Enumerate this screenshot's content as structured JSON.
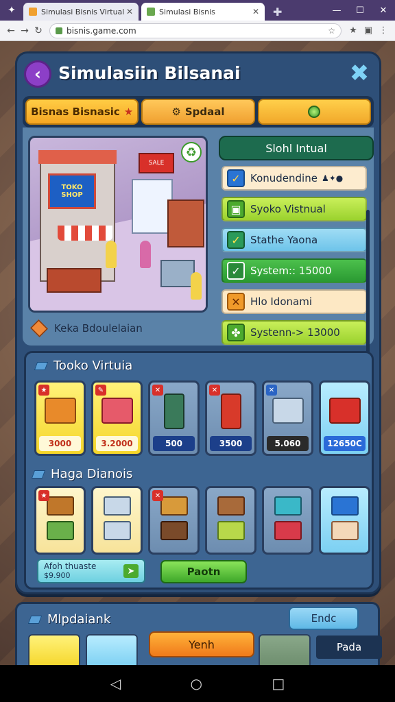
{
  "browser": {
    "tabs": [
      {
        "title": "Simulasi Bisnis Virtual",
        "fav_color": "#f0a030"
      },
      {
        "title": "Simulasi Bisnis",
        "fav_color": "#6aa84f"
      }
    ],
    "url": "bisnis.game.com",
    "icons": [
      "puzzle-icon",
      "new-tab-icon",
      "minimize-icon",
      "maximize-icon",
      "close-icon",
      "back-icon",
      "forward-icon",
      "reload-icon",
      "star-icon",
      "extension-icon"
    ]
  },
  "game": {
    "title": "Simulasiin Bilsanai",
    "tabs": [
      {
        "label": "Bisnas Bisnasic",
        "icon": "★"
      },
      {
        "label": "Spdaal",
        "icon": "⚙"
      },
      {
        "label": ""
      }
    ],
    "scene": {
      "billboard": "TOKO SHOP",
      "red_sign": "SALE",
      "caption": "Keka Bdoulelaian"
    },
    "side_header": "Slohl Intual",
    "side_items": [
      {
        "label": "Konudendine",
        "mark": "✓",
        "extras": "♟✦●"
      },
      {
        "label": "Syoko Vistnual",
        "mark": "▣"
      },
      {
        "label": "Stathe Yaona",
        "mark": "✓"
      },
      {
        "label": "System:: 15000",
        "mark": "✓"
      },
      {
        "label": "Hlo Idonami",
        "mark": "✕"
      },
      {
        "label": "Systenn-> 13000",
        "mark": "✤"
      }
    ],
    "store_title": "Tooko Virtuia",
    "store_items": [
      {
        "price": "3000"
      },
      {
        "price": "3.2000"
      },
      {
        "price": "500"
      },
      {
        "price": "3500"
      },
      {
        "price": "5.060"
      },
      {
        "price": "12650C"
      }
    ],
    "second_title": "Haga Dianois",
    "promo": {
      "line1": "Afoh thuaste",
      "line2": "$9.900"
    },
    "primary_button": "Paotn",
    "bottom_title": "Mlpdaiank",
    "bottom_buttons": {
      "back": "Endc",
      "orange": "Yenh",
      "navy": "Pada"
    }
  }
}
